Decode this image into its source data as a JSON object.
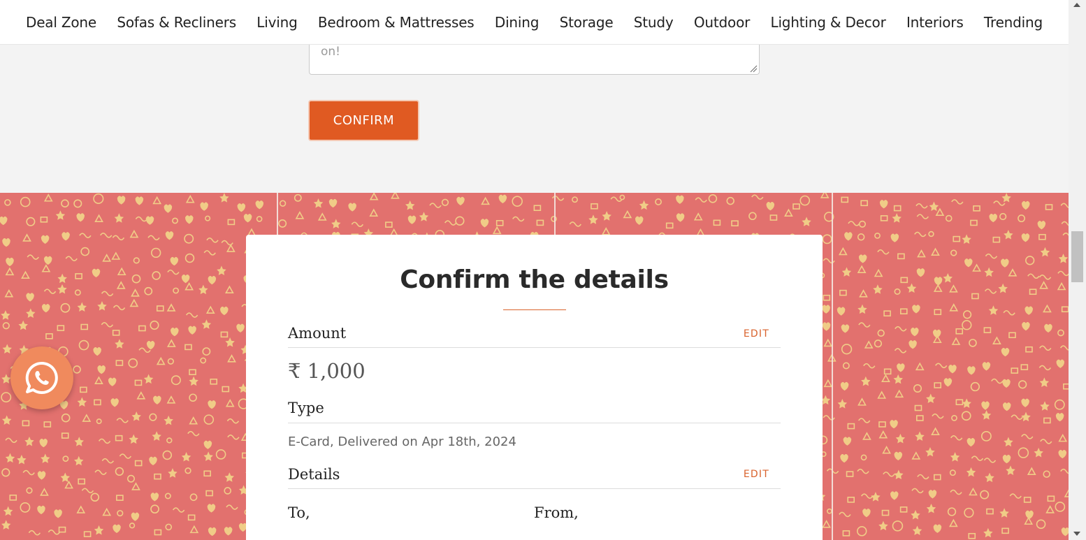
{
  "nav": {
    "items": [
      "Deal Zone",
      "Sofas & Recliners",
      "Living",
      "Bedroom & Mattresses",
      "Dining",
      "Storage",
      "Study",
      "Outdoor",
      "Lighting & Decor",
      "Interiors",
      "Trending"
    ]
  },
  "form": {
    "message_tail": "on!",
    "confirm_label": "CONFIRM"
  },
  "card": {
    "title": "Confirm the details",
    "amount": {
      "label": "Amount",
      "edit_label": "EDIT",
      "value": "₹ 1,000"
    },
    "type": {
      "label": "Type",
      "value": "E-Card, Delivered on Apr 18th, 2024"
    },
    "details": {
      "label": "Details",
      "edit_label": "EDIT",
      "to_label": "To,",
      "from_label": "From,"
    }
  },
  "colors": {
    "accent": "#e05a22",
    "pattern_bg": "#e2716e",
    "pattern_ink": "#f3dd8c",
    "whatsapp_bg": "#f08a5d"
  },
  "icons": {
    "chat": "whatsapp-icon",
    "resize": "resize-grip-icon"
  }
}
